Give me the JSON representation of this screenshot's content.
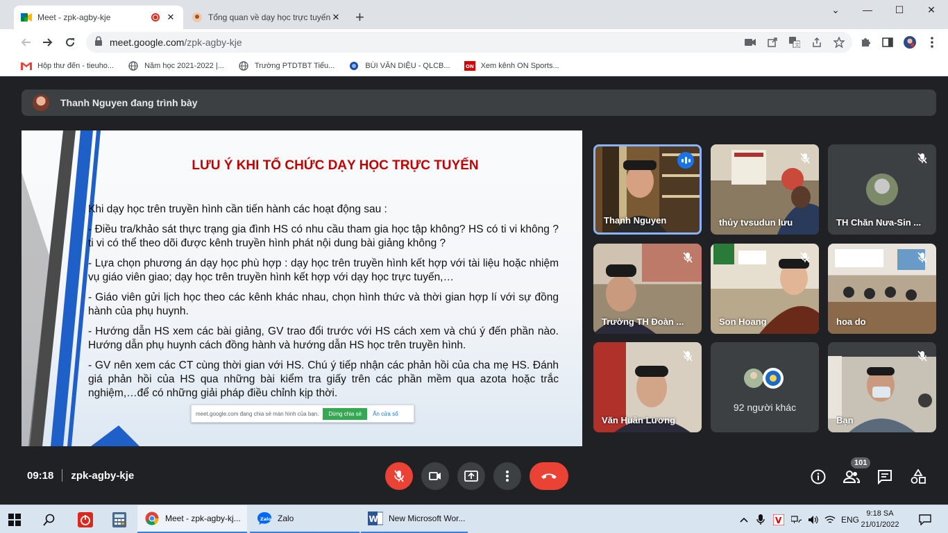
{
  "browser": {
    "tabs": [
      {
        "title": "Meet - zpk-agby-kje",
        "active": true,
        "recording": true
      },
      {
        "title": "Tổng quan về dạy học trực tuyến – (",
        "active": false
      }
    ],
    "new_tab_label": "+",
    "window_controls": {
      "minimize": "⌄",
      "restore": "—",
      "maximize": "☐",
      "close": "✕"
    },
    "url_host": "meet.google.com",
    "url_path": "/zpk-agby-kje",
    "bookmarks": [
      {
        "label": "Hộp thư đến - tieuho...",
        "icon": "gmail-icon"
      },
      {
        "label": "Năm học 2021-2022 |...",
        "icon": "globe-icon"
      },
      {
        "label": "Trường PTDTBT Tiểu...",
        "icon": "globe-icon"
      },
      {
        "label": "BÙI VĂN DIỆU - QLCB...",
        "icon": "qlcb-icon"
      },
      {
        "label": "Xem kênh ON Sports...",
        "icon": "on-icon"
      }
    ]
  },
  "meet": {
    "presenter_text": "Thanh Nguyen đang trình bày",
    "slide": {
      "title": "LƯU Ý KHI TỔ CHỨC DẠY HỌC TRỰC TUYẾN",
      "paragraphs": [
        "Khi dạy học trên truyền hình cần tiến hành các hoạt động sau :",
        "- Điều tra/khảo sát thực trạng gia đình HS có nhu cầu tham gia học tập không? HS có ti vi không ? ti vi có thể theo dõi được kênh truyền hình phát nội dung bài giảng không ?",
        "- Lựa chọn phương án dạy học phù hợp : dạy học trên truyền hình kết hợp với tài liệu hoặc nhiệm vụ giáo viên giao; dạy học trên truyền hình kết hợp với dạy học trực tuyến,…",
        "- Giáo viên gửi lịch học theo các kênh khác nhau, chọn hình thức và thời gian hợp lí với sự đồng hành của phụ huynh.",
        "- Hướng dẫn HS xem các bài giảng, GV trao đổi trước với HS cách xem và chú ý đến phần nào. Hướng dẫn phụ huynh cách đồng hành và hướng dẫn HS học trên truyền hình.",
        "- GV nên xem các CT cùng thời gian với HS. Chú ý tiếp nhận các phản hồi của cha mẹ HS. Đánh giá phản hồi của HS qua những bài kiểm tra giấy trên các phần mềm qua azota hoặc trắc nghiệm,…để có những giải pháp điều chỉnh kịp thời."
      ],
      "share_notice": {
        "text": "meet.google.com đang chia sẻ màn hình của bạn.",
        "stop": "Dừng chia sẻ",
        "hide": "Ẩn cửa sổ"
      }
    },
    "participants": [
      {
        "name": "Thanh Nguyen",
        "speaking": true
      },
      {
        "name": "thủy tvsudun lưu",
        "muted": true
      },
      {
        "name": "TH Chăn Nưa-Sin ...",
        "muted": true,
        "avatar": true
      },
      {
        "name": "Trường TH Đoàn ...",
        "muted": true
      },
      {
        "name": "Son Hoang",
        "muted": true
      },
      {
        "name": "hoa do",
        "muted": true
      },
      {
        "name": "Văn Huân Lương",
        "muted": true
      },
      {
        "name": "92 người khác"
      },
      {
        "name": "Bạn",
        "muted": true
      }
    ],
    "time": "09:18",
    "meeting_code": "zpk-agby-kje",
    "participant_count": "101"
  },
  "taskbar": {
    "apps": [
      {
        "label": "Meet - zpk-agby-kj...",
        "icon": "chrome-icon"
      },
      {
        "label": "Zalo",
        "icon": "zalo-icon"
      },
      {
        "label": "New Microsoft Wor...",
        "icon": "word-icon"
      }
    ],
    "language": "ENG",
    "time": "9:18 SA",
    "date": "21/01/2022"
  }
}
